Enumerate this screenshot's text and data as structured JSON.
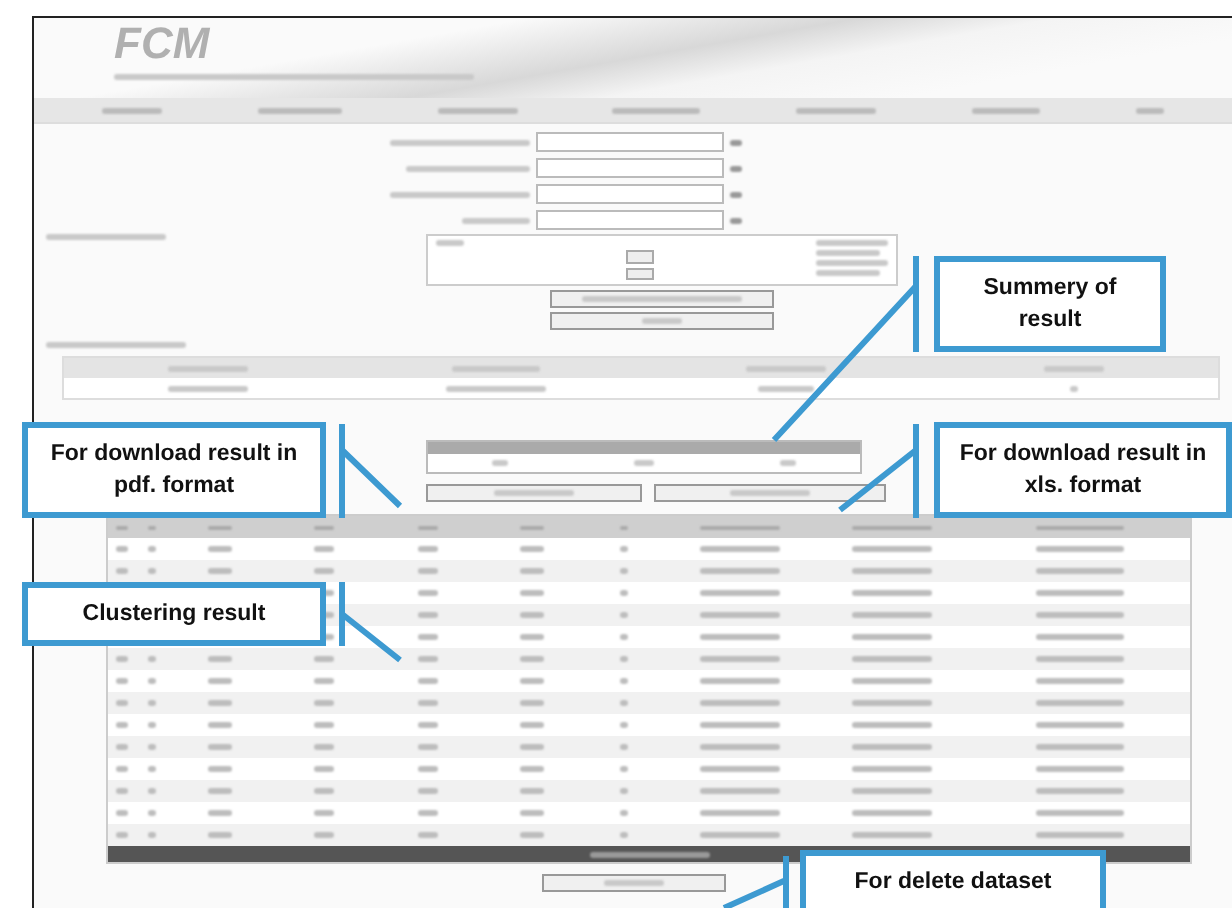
{
  "logo": "FCM",
  "callouts": [
    {
      "kind": "summary",
      "text": "Summery of result"
    },
    {
      "kind": "pdf",
      "text": "For download result in pdf. format"
    },
    {
      "kind": "xls",
      "text": "For download result in xls. format"
    },
    {
      "kind": "table",
      "text": "Clustering result"
    },
    {
      "kind": "delete",
      "text": "For delete dataset"
    }
  ]
}
